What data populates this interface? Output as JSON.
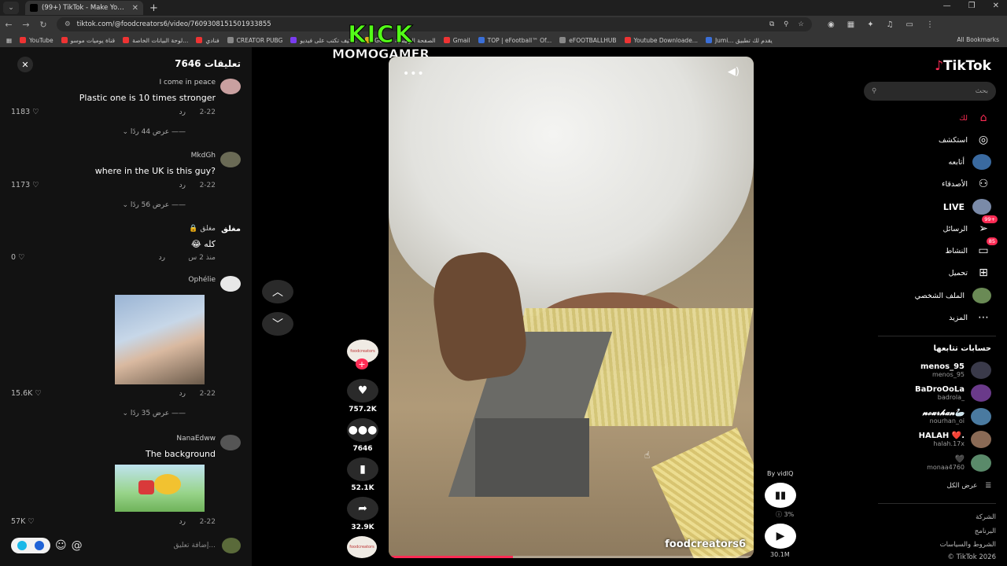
{
  "browser": {
    "tab_title": "(99+) TikTok - Make Your Day",
    "url": "tiktok.com/@foodcreators6/video/7609308151501933855",
    "bookmarks": [
      "YouTube",
      "قناة يوميات موسو",
      "لوحة البيانات الخاصة...",
      "فنادي",
      "CREATOR PUBG",
      "كيف تكتب على فيديو...",
      "Go... – الصفحة الرئيسية",
      "Gmail",
      "TOP | eFootball™ Of...",
      "eFOOTBALLHUB",
      "Youtube Downloade...",
      "Jumi... يقدم لك تطبيق"
    ],
    "all_bookmarks": "All Bookmarks"
  },
  "overlay": {
    "line1": "KICK",
    "line2": "MOMOGAMER"
  },
  "comments": {
    "header": "تعليقات 7646",
    "items": [
      {
        "user": "I come in peace",
        "text": "Plastic one is 10 times stronger",
        "date": "2-22",
        "reply": "رد",
        "likes": "1183",
        "view_replies": "عرض 44 ردًا"
      },
      {
        "user": "MkdGh",
        "text": "?where in the UK is this guy",
        "date": "2-22",
        "reply": "رد",
        "likes": "1173",
        "view_replies": "عرض 56 ردًا"
      },
      {
        "user": "مغلق 🔒",
        "avatar_label": "مغلق",
        "text": "كله 😂",
        "date": "منذ 2 س",
        "reply": "رد",
        "likes": "0"
      },
      {
        "user": "Ophélie",
        "date": "2-22",
        "reply": "رد",
        "likes": "15.6K",
        "view_replies": "عرض 35 ردًا"
      },
      {
        "user": "NanaEdww",
        "text": "The background",
        "date": "2-22",
        "reply": "رد",
        "likes": "57K"
      }
    ],
    "input_placeholder": "إضافة تعليق..."
  },
  "video": {
    "author": "foodcreators6",
    "progress_fraction": 0.34
  },
  "actions": {
    "avatar_text": "foodcreators",
    "likes": "757.2K",
    "comments": "7646",
    "saves": "52.1K",
    "shares": "32.9K"
  },
  "vidiq": {
    "by": "By vidIQ",
    "percent": "3%",
    "views": "30.1M"
  },
  "sidebar": {
    "logo": "TikTok",
    "search_placeholder": "بحث",
    "nav": [
      {
        "label": "لك",
        "icon": "home-icon"
      },
      {
        "label": "استكشف",
        "icon": "compass-icon"
      },
      {
        "label": "أتابعه",
        "icon": "following-icon"
      },
      {
        "label": "الأصدقاء",
        "icon": "friends-icon"
      },
      {
        "label": "LIVE",
        "icon": "live-icon"
      },
      {
        "label": "الرسائل",
        "icon": "messages-icon",
        "badge": "99+"
      },
      {
        "label": "النشاط",
        "icon": "activity-icon",
        "badge": "85"
      },
      {
        "label": "تحميل",
        "icon": "upload-icon"
      },
      {
        "label": "الملف الشخصي",
        "icon": "profile-icon"
      },
      {
        "label": "المزيد",
        "icon": "more-icon"
      }
    ],
    "following_header": "حسابات تتابعها",
    "accounts": [
      {
        "name": "menos_95",
        "user": "menos_95"
      },
      {
        "name": "BaDroOoLa",
        "user": "badrola_"
      },
      {
        "name": "𝓷𝓸𝓾𝓻𝓱𝓪𝓷🦢",
        "user": "nourhan_oi"
      },
      {
        "name": "HALAH ❤️.",
        "user": "halah.17x"
      },
      {
        "name": "🖤",
        "user": "monaa4760"
      }
    ],
    "see_all": "عرض الكل",
    "footer": [
      "الشركة",
      "البرنامج",
      "الشروط والسياسات",
      "TikTok 2026 ©"
    ]
  }
}
